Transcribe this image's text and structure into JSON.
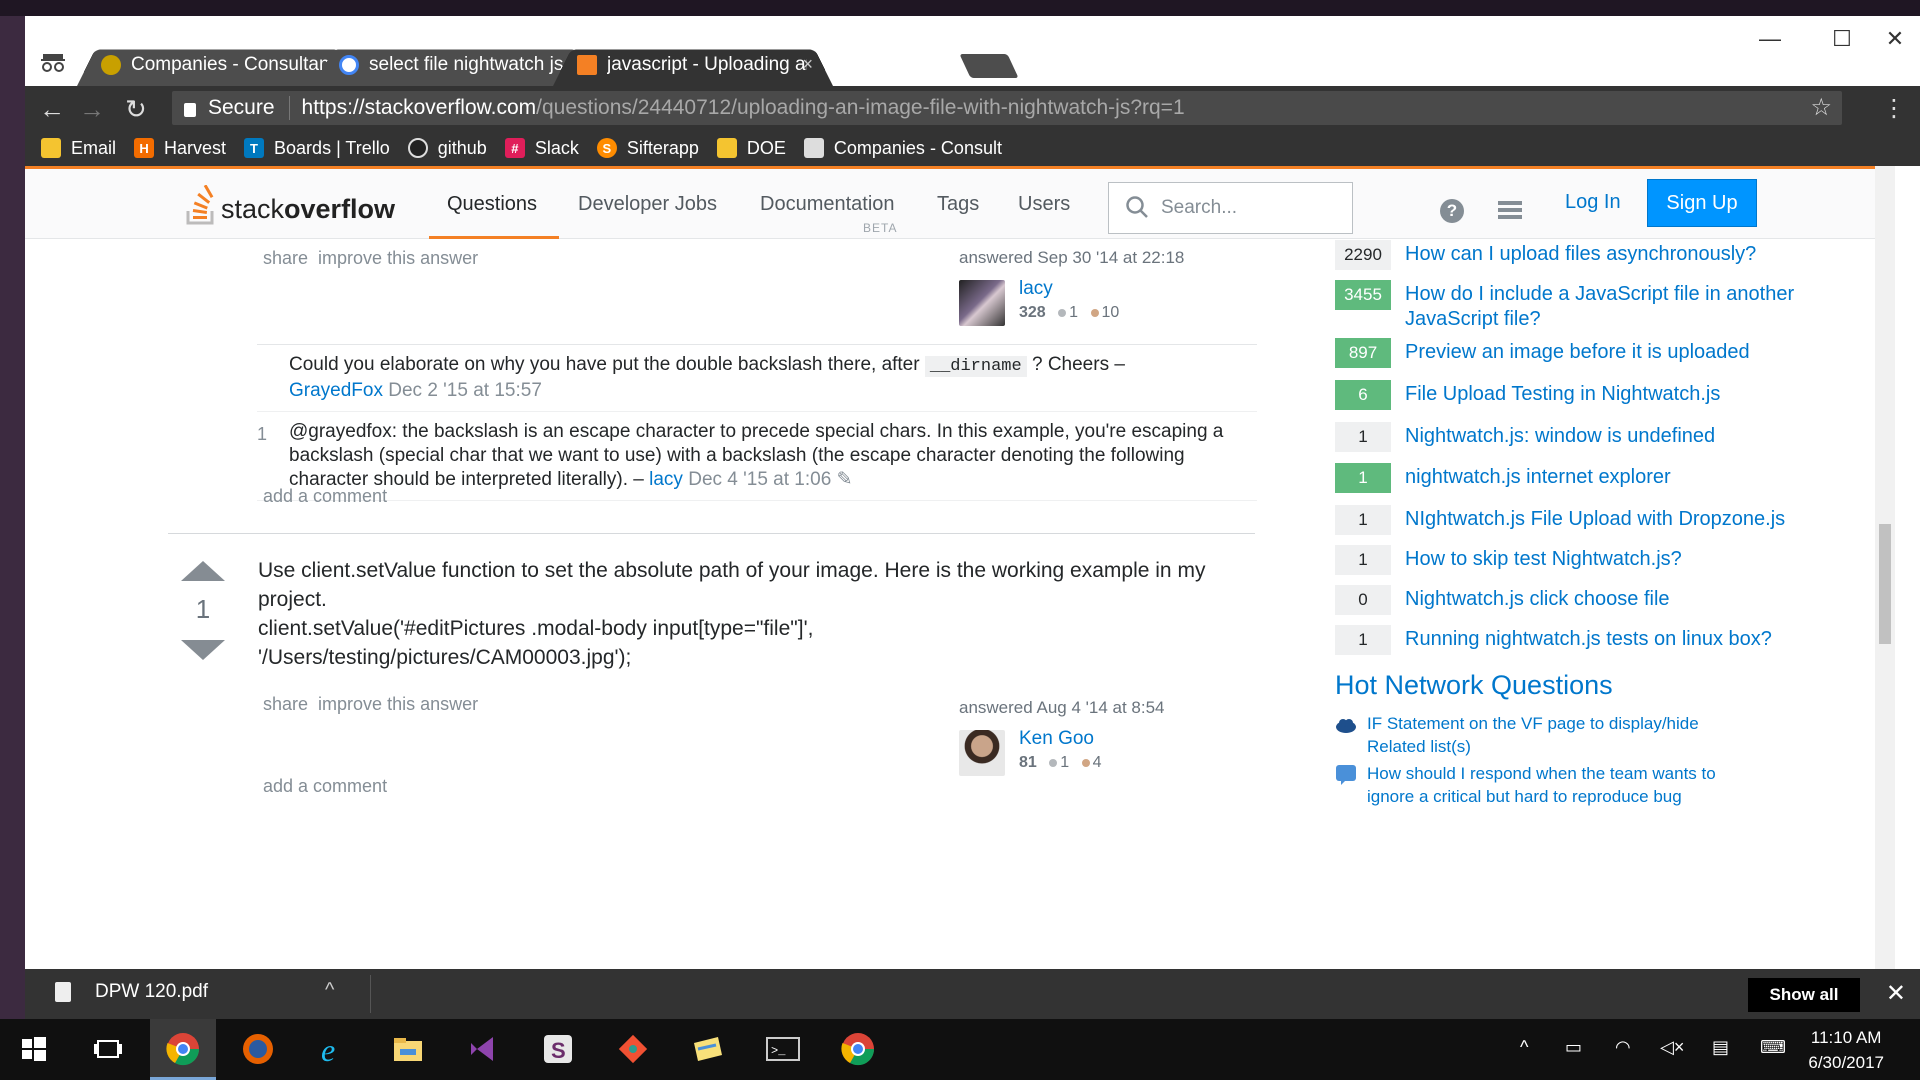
{
  "browser": {
    "tabs": [
      {
        "title": "Companies - Consultant",
        "favicon_color": "#c8a000"
      },
      {
        "title": "select file nightwatch js -",
        "favicon_color": "#4285f4"
      },
      {
        "title": "javascript - Uploading an",
        "favicon_color": "#f48024"
      }
    ],
    "omnibox": {
      "secure_label": "Secure",
      "host": "https://stackoverflow.com",
      "path": "/questions/24440712/uploading-an-image-file-with-nightwatch-js?rq=1"
    },
    "bookmarks": [
      {
        "label": "Email",
        "color": "#f4c430",
        "glyph": ""
      },
      {
        "label": "Harvest",
        "color": "#f36c00",
        "glyph": "H"
      },
      {
        "label": "Boards | Trello",
        "color": "#0079bf",
        "glyph": "T"
      },
      {
        "label": "github",
        "color": "#222222",
        "glyph": ""
      },
      {
        "label": "Slack",
        "color": "#e01e5a",
        "glyph": "#"
      },
      {
        "label": "Sifterapp",
        "color": "#ff8c00",
        "glyph": "S"
      },
      {
        "label": "DOE",
        "color": "#f4c430",
        "glyph": ""
      },
      {
        "label": "Companies - Consult",
        "color": "#dddddd",
        "glyph": ""
      }
    ]
  },
  "so": {
    "logo_prefix": "stack",
    "logo_suffix": "overflow",
    "nav": {
      "questions": "Questions",
      "jobs": "Developer Jobs",
      "documentation": "Documentation",
      "beta": "BETA",
      "tags": "Tags",
      "users": "Users"
    },
    "search_placeholder": "Search...",
    "login": "Log In",
    "signup": "Sign Up",
    "accent": "#f48024",
    "link_color": "#0077cc"
  },
  "answer1": {
    "menu_share": "share",
    "menu_improve": "improve this answer",
    "answered": "answered Sep 30 '14 at 22:18",
    "user": "lacy",
    "rep": "328",
    "silver": "1",
    "bronze": "10",
    "comments": [
      {
        "score": "",
        "text_before": "Could you elaborate on why you have put the double backslash there, after",
        "code": "__dirname",
        "text_after": "? Cheers –",
        "user": "GrayedFox",
        "date": "Dec 2 '15 at 15:57"
      },
      {
        "score": "1",
        "text": "@grayedfox: the backslash is an escape character to precede special chars. In this example, you're escaping a backslash (special char that we want to use) with a backslash (the escape character denoting the following character should be interpreted literally). –",
        "user": "lacy",
        "date": "Dec 4 '15 at 1:06",
        "edited_glyph": "✎"
      }
    ],
    "add_comment": "add a comment"
  },
  "answer2": {
    "votes": "1",
    "text1": "Use client.setValue function to set the absolute path of your image. Here is the working example in my project.",
    "text2": "client.setValue('#editPictures .modal-body input[type=\"file\"]', '/Users/testing/pictures/CAM00003.jpg');",
    "menu_share": "share",
    "menu_improve": "improve this answer",
    "answered": "answered Aug 4 '14 at 8:54",
    "user": "Ken Goo",
    "rep": "81",
    "silver": "1",
    "bronze": "4",
    "add_comment": "add a comment"
  },
  "sidebar": {
    "related": [
      {
        "count": "2290",
        "accepted": false,
        "title": "How can I upload files asynchronously?"
      },
      {
        "count": "3455",
        "accepted": true,
        "title": "How do I include a JavaScript file in another JavaScript file?"
      },
      {
        "count": "897",
        "accepted": true,
        "title": "Preview an image before it is uploaded"
      },
      {
        "count": "6",
        "accepted": true,
        "title": "File Upload Testing in Nightwatch.js"
      },
      {
        "count": "1",
        "accepted": false,
        "title": "Nightwatch.js: window is undefined"
      },
      {
        "count": "1",
        "accepted": true,
        "title": "nightwatch.js internet explorer"
      },
      {
        "count": "1",
        "accepted": false,
        "title": "NIghtwatch.js File Upload with Dropzone.js"
      },
      {
        "count": "1",
        "accepted": false,
        "title": "How to skip test Nightwatch.js?"
      },
      {
        "count": "0",
        "accepted": false,
        "title": "Nightwatch.js click choose file"
      },
      {
        "count": "1",
        "accepted": false,
        "title": "Running nightwatch.js tests on linux box?"
      }
    ],
    "hot_title": "Hot Network Questions",
    "hot": [
      {
        "title": "IF Statement on the VF page to display/hide Related list(s)",
        "icon_color": "#1e4f8c"
      },
      {
        "title": "How should I respond when the team wants to ignore a critical but hard to reproduce bug",
        "icon_color": "#4a90d9"
      }
    ]
  },
  "download_shelf": {
    "file": "DPW 120.pdf",
    "show_all": "Show all"
  },
  "taskbar": {
    "time": "11:10 AM",
    "date": "6/30/2017"
  }
}
